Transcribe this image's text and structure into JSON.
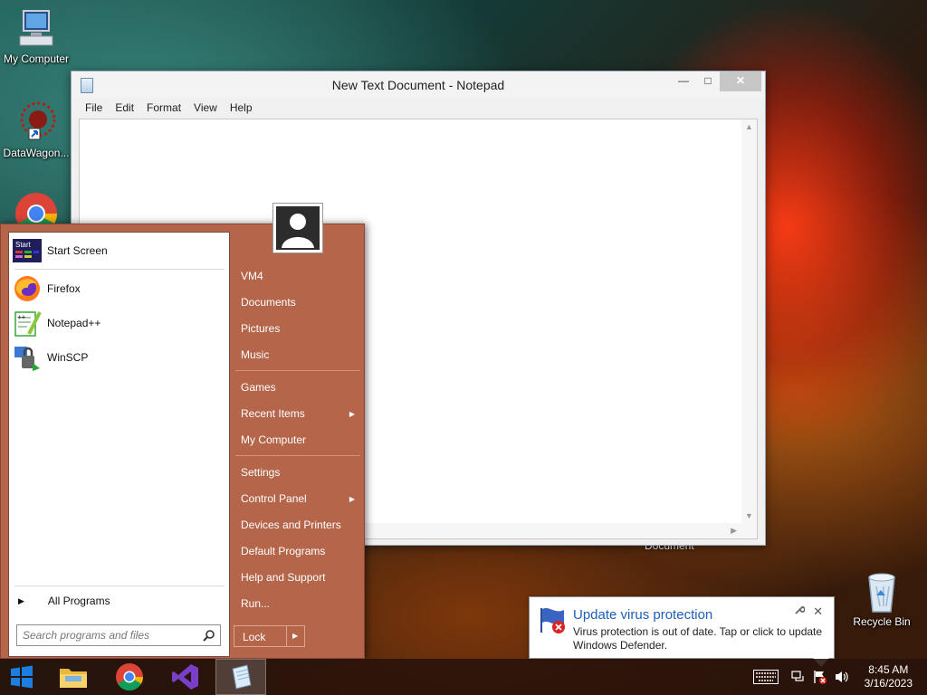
{
  "desktop": {
    "icons": [
      {
        "label": "My Computer"
      },
      {
        "label": "DataWagon..."
      },
      {
        "label": "Recycle Bin"
      }
    ],
    "partial_label": "Document"
  },
  "notepad": {
    "title": "New Text Document - Notepad",
    "menu": [
      "File",
      "Edit",
      "Format",
      "View",
      "Help"
    ],
    "content": ""
  },
  "start_menu": {
    "pinned": [
      {
        "label": "Start Screen",
        "icon": "start-screen-icon"
      },
      {
        "label": "Firefox",
        "icon": "firefox-icon"
      },
      {
        "label": "Notepad++",
        "icon": "notepadpp-icon"
      },
      {
        "label": "WinSCP",
        "icon": "winscp-icon"
      }
    ],
    "all_programs": "All Programs",
    "search_placeholder": "Search programs and files",
    "right_items": [
      {
        "label": "VM4"
      },
      {
        "label": "Documents"
      },
      {
        "label": "Pictures"
      },
      {
        "label": "Music"
      },
      {
        "label": "Games"
      },
      {
        "label": "Recent Items"
      },
      {
        "label": "My Computer"
      },
      {
        "label": "Settings"
      },
      {
        "label": "Control Panel"
      },
      {
        "label": "Devices and Printers"
      },
      {
        "label": "Default Programs"
      },
      {
        "label": "Help and Support"
      },
      {
        "label": "Run..."
      }
    ],
    "lock_label": "Lock"
  },
  "notification": {
    "title": "Update virus protection",
    "body": "Virus protection is out of date. Tap or click to update Windows Defender."
  },
  "taskbar": {
    "time": "8:45 AM",
    "date": "3/16/2023"
  }
}
